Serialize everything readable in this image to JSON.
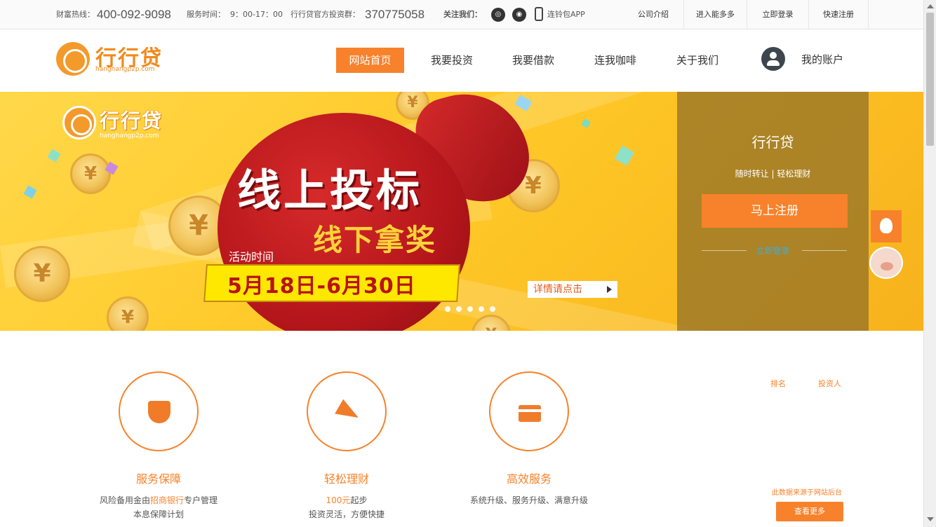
{
  "topbar": {
    "hotline_label": "财富热线：",
    "hotline_number": "400-092-9098",
    "service_label": "服务时间：",
    "service_time": "9：00-17：00",
    "qq_group_label": "行行贷官方投资群：",
    "qq_group_number": "370775058",
    "follow_label": "关注我们：",
    "app_label": "连铃包APP",
    "links": [
      "公司介绍",
      "进入能多多",
      "立即登录",
      "快速注册"
    ]
  },
  "header": {
    "logo_text": "行行贷",
    "logo_sub": "hanghangp2p.com",
    "nav": [
      "网站首页",
      "我要投资",
      "我要借款",
      "连我咖啡",
      "关于我们"
    ],
    "active_nav": "网站首页",
    "account_label": "我的账户"
  },
  "banner": {
    "logo_text": "行行贷",
    "logo_sub": "hanghangp2p.com",
    "headline": "线上投标",
    "subheadline": "线下拿奖",
    "activity_label": "活动时间",
    "dates": "5月18日-6月30日",
    "detail_button": "详情请点击",
    "coin_symbol": "¥",
    "slide_count": 5
  },
  "login_panel": {
    "title": "行行贷",
    "subtitle": "随时转让 | 轻松理财",
    "register_button": "马上注册",
    "login_link": "立即登录"
  },
  "features": [
    {
      "icon": "shield-icon",
      "title": "服务保障",
      "line1_pre": "风险备用金由",
      "line1_hl": "招商银行",
      "line1_post": "专户管理",
      "line2": "本息保障计划"
    },
    {
      "icon": "paper-plane-icon",
      "title": "轻松理财",
      "line1_pre": "",
      "line1_hl": "100元",
      "line1_post": "起步",
      "line2": "投资灵活，方便快捷"
    },
    {
      "icon": "card-icon",
      "title": "高效服务",
      "line1_pre": "系统升级、服务升级、满意升级",
      "line1_hl": "",
      "line1_post": "",
      "line2": ""
    }
  ],
  "ranking": {
    "col_rank": "排名",
    "col_investor": "投资人",
    "note": "此数据来源于网站后台",
    "more_button": "查看更多"
  },
  "colors": {
    "accent": "#f7822b",
    "banner_yellow": "#ffc928",
    "bag_red": "#b5161b",
    "login_link": "#3ab0e6"
  }
}
